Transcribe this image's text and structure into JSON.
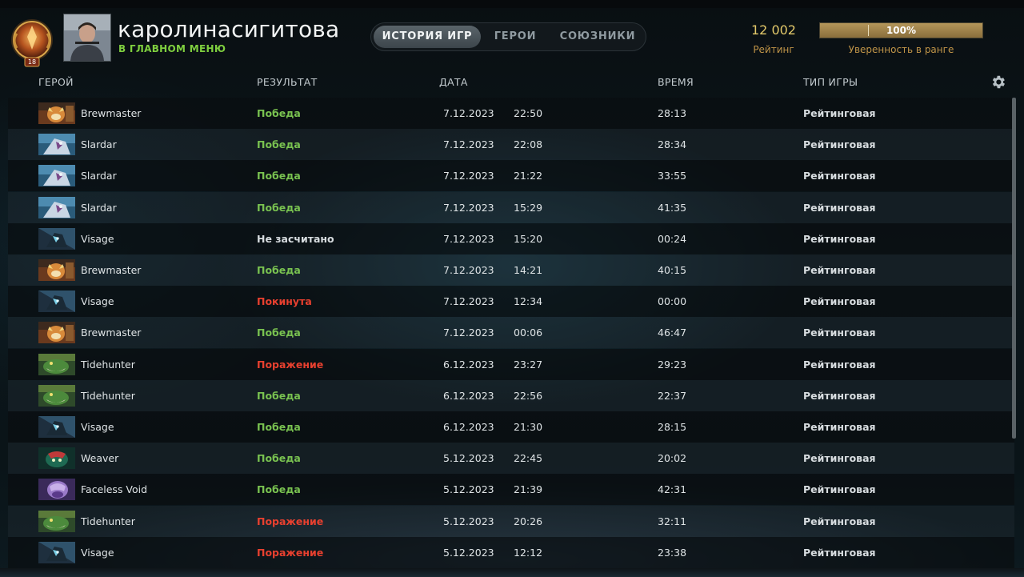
{
  "profile": {
    "rank_level": "18",
    "name": "каролинасигитова",
    "status": "В ГЛАВНОМ МЕНЮ"
  },
  "tabs": [
    {
      "label": "ИСТОРИЯ ИГР",
      "active": true
    },
    {
      "label": "ГЕРОИ",
      "active": false
    },
    {
      "label": "СОЮЗНИКИ",
      "active": false
    }
  ],
  "rating": {
    "value": "12 002",
    "label": "Рейтинг",
    "confidence_text": "100%",
    "confidence_fraction": 1.0,
    "confidence_label": "Уверенность в ранге"
  },
  "columns": {
    "hero": "ГЕРОЙ",
    "result": "РЕЗУЛЬТАТ",
    "date": "ДАТА",
    "duration": "ВРЕМЯ",
    "game_type": "ТИП ИГРЫ"
  },
  "colors": {
    "win": "#79c250",
    "loss": "#e8402f",
    "status_online": "#7fcf3f",
    "rating_gold": "#e3c96a"
  },
  "matches": [
    {
      "hero": "Brewmaster",
      "icon": "brewmaster-icon",
      "result": "Победа",
      "result_kind": "win",
      "date": "7.12.2023",
      "time": "22:50",
      "duration": "28:13",
      "type": "Рейтинговая"
    },
    {
      "hero": "Slardar",
      "icon": "slardar-icon",
      "result": "Победа",
      "result_kind": "win",
      "date": "7.12.2023",
      "time": "22:08",
      "duration": "28:34",
      "type": "Рейтинговая"
    },
    {
      "hero": "Slardar",
      "icon": "slardar-icon",
      "result": "Победа",
      "result_kind": "win",
      "date": "7.12.2023",
      "time": "21:22",
      "duration": "33:55",
      "type": "Рейтинговая"
    },
    {
      "hero": "Slardar",
      "icon": "slardar-icon",
      "result": "Победа",
      "result_kind": "win",
      "date": "7.12.2023",
      "time": "15:29",
      "duration": "41:35",
      "type": "Рейтинговая"
    },
    {
      "hero": "Visage",
      "icon": "visage-icon",
      "result": "Не засчитано",
      "result_kind": "neutral",
      "date": "7.12.2023",
      "time": "15:20",
      "duration": "00:24",
      "type": "Рейтинговая"
    },
    {
      "hero": "Brewmaster",
      "icon": "brewmaster-icon",
      "result": "Победа",
      "result_kind": "win",
      "date": "7.12.2023",
      "time": "14:21",
      "duration": "40:15",
      "type": "Рейтинговая"
    },
    {
      "hero": "Visage",
      "icon": "visage-icon",
      "result": "Покинута",
      "result_kind": "loss",
      "date": "7.12.2023",
      "time": "12:34",
      "duration": "00:00",
      "type": "Рейтинговая"
    },
    {
      "hero": "Brewmaster",
      "icon": "brewmaster-icon",
      "result": "Победа",
      "result_kind": "win",
      "date": "7.12.2023",
      "time": "00:06",
      "duration": "46:47",
      "type": "Рейтинговая"
    },
    {
      "hero": "Tidehunter",
      "icon": "tidehunter-icon",
      "result": "Поражение",
      "result_kind": "loss",
      "date": "6.12.2023",
      "time": "23:27",
      "duration": "29:23",
      "type": "Рейтинговая"
    },
    {
      "hero": "Tidehunter",
      "icon": "tidehunter-icon",
      "result": "Победа",
      "result_kind": "win",
      "date": "6.12.2023",
      "time": "22:56",
      "duration": "22:37",
      "type": "Рейтинговая"
    },
    {
      "hero": "Visage",
      "icon": "visage-icon",
      "result": "Победа",
      "result_kind": "win",
      "date": "6.12.2023",
      "time": "21:30",
      "duration": "28:15",
      "type": "Рейтинговая"
    },
    {
      "hero": "Weaver",
      "icon": "weaver-icon",
      "result": "Победа",
      "result_kind": "win",
      "date": "5.12.2023",
      "time": "22:45",
      "duration": "20:02",
      "type": "Рейтинговая"
    },
    {
      "hero": "Faceless Void",
      "icon": "faceless-void-icon",
      "result": "Победа",
      "result_kind": "win",
      "date": "5.12.2023",
      "time": "21:39",
      "duration": "42:31",
      "type": "Рейтинговая"
    },
    {
      "hero": "Tidehunter",
      "icon": "tidehunter-icon",
      "result": "Поражение",
      "result_kind": "loss",
      "date": "5.12.2023",
      "time": "20:26",
      "duration": "32:11",
      "type": "Рейтинговая"
    },
    {
      "hero": "Visage",
      "icon": "visage-icon",
      "result": "Поражение",
      "result_kind": "loss",
      "date": "5.12.2023",
      "time": "12:12",
      "duration": "23:38",
      "type": "Рейтинговая"
    }
  ]
}
